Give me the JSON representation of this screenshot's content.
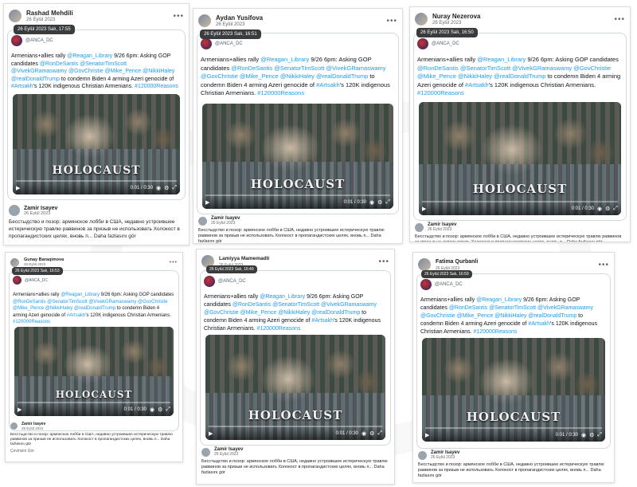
{
  "tweet": {
    "handle": "@ANCA_DC",
    "text_plain1": "Armenians+allies rally ",
    "link1": "@Reagan_Library",
    "text_plain2": " 9/26 6pm: Asking GOP candidates ",
    "links_gop": "@RonDeSantis @SenatorTimScott @VivekGRamaswamy @GovChristie @Mike_Pence @NikkiHaley @realDonaldTrump",
    "text_plain3": " to condemn Biden 4 arming Azeri genocide of ",
    "link2": "#Artsakh",
    "text_plain4": "'s 120K indigenous Christian Armenians. ",
    "link3": "#120000Reasons",
    "video_title": "HOLOCAUST",
    "video_time": "0:01 / 0:30"
  },
  "comment": {
    "author": "Zamir Isayev",
    "date": "26 Eylül 2023",
    "text_short": "Бесстыдство и позор: армянское лобби в США, недавно устроившее истерическую травлю раввинов за призыв не использовать Холокост в пропагандистских целях, вновь п... Daha fazlasını gör"
  },
  "panels": [
    {
      "name": "Rashad Mehdili",
      "date": "26 Eylül 2023",
      "tooltip": "26 Eylül 2023 Salı, 17:55"
    },
    {
      "name": "Aydan Yusifova",
      "date": "26 Eylül 2023",
      "tooltip": "26 Eylül 2023 Salı, 16:51"
    },
    {
      "name": "Nuray Nezerova",
      "date": "26 Eylül 2023",
      "tooltip": "26 Eylül 2023 Salı, 16:50"
    },
    {
      "name": "Gunay Baraqimova",
      "date": "26 Eylül 2023",
      "tooltip": "26 Eylül 2023 Salı, 16:53"
    },
    {
      "name": "Lamiyya Mamemadli",
      "date": "26 Eylül 2023",
      "tooltip": "26 Eylül 2023 Salı, 16:49"
    },
    {
      "name": "Fatima Qurbanli",
      "date": "26 Eylül 2023",
      "tooltip": "26 Eylül 2023 Salı, 16:59"
    }
  ],
  "footer_small": "Çevirisini Gör"
}
